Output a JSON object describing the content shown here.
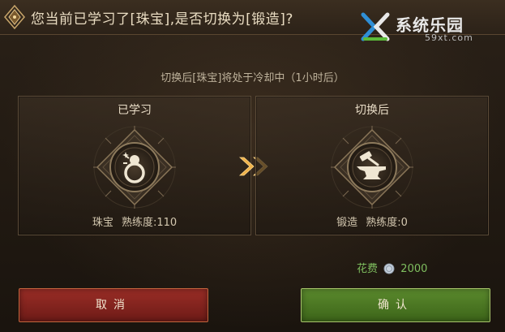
{
  "dialog": {
    "title": "您当前已学习了[珠宝],是否切换为[锻造]?",
    "subtitle": "切换后[珠宝]将处于冷却中（1小时后）"
  },
  "learned_panel": {
    "header": "已学习",
    "skill_name": "珠宝",
    "proficiency": "熟练度:110",
    "icon": "ring-icon"
  },
  "switch_panel": {
    "header": "切换后",
    "skill_name": "锻造",
    "proficiency": "熟练度:0",
    "icon": "anvil-icon"
  },
  "cost": {
    "label": "花费",
    "value": "2000",
    "icon": "silver-coin-icon"
  },
  "buttons": {
    "cancel": "取消",
    "confirm": "确认"
  },
  "watermark": {
    "name": "系统乐园",
    "url": "59xt.com"
  },
  "colors": {
    "cost_green": "#7fbf5f",
    "cancel_red": "#8a2620",
    "confirm_green": "#4c7a22",
    "arrow_gold": "#f0b24a"
  }
}
